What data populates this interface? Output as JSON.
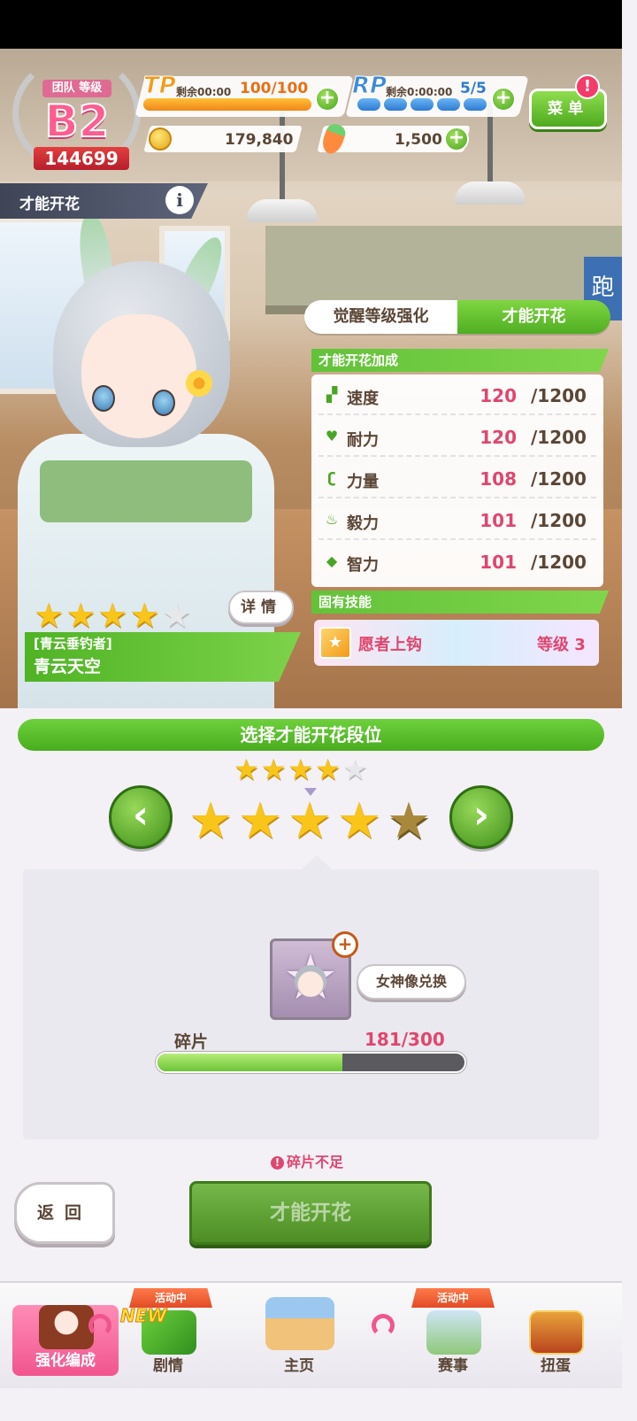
{
  "header": {
    "team_rank_label": "团队 等级",
    "team_grade": "B2",
    "team_score": "144699",
    "tp": {
      "label": "TP",
      "remaining": "剩余00:00",
      "value": "100/100",
      "fill": 1.0
    },
    "rp": {
      "label": "RP",
      "remaining": "剩余0:00:00",
      "value": "5/5",
      "pips": 5
    },
    "coins": "179,840",
    "carrots": "1,500",
    "menu_label": "菜单",
    "menu_alert": "!"
  },
  "page": {
    "title": "才能开花",
    "info_icon": "i"
  },
  "tabs": [
    {
      "label": "觉醒等级强化",
      "active": false
    },
    {
      "label": "才能开花",
      "active": true
    }
  ],
  "bonus": {
    "section_label": "才能开花加成",
    "stats": [
      {
        "icon": "shoe-icon",
        "name": "速度",
        "value": "120",
        "max": "/1200"
      },
      {
        "icon": "heart-icon",
        "name": "耐力",
        "value": "120",
        "max": "/1200"
      },
      {
        "icon": "muscle-icon",
        "name": "力量",
        "value": "108",
        "max": "/1200"
      },
      {
        "icon": "flame-icon",
        "name": "毅力",
        "value": "101",
        "max": "/1200"
      },
      {
        "icon": "graduation-cap-icon",
        "name": "智力",
        "value": "101",
        "max": "/1200"
      }
    ]
  },
  "unique_skill": {
    "section_label": "固有技能",
    "name": "愿者上钩",
    "level": "等级 3"
  },
  "character": {
    "stars": 4,
    "max_stars": 5,
    "detail_label": "详情",
    "title": "[青云垂钓者]",
    "name": "青云天空"
  },
  "bloom": {
    "section_label": "选择才能开花段位",
    "current_stars": 4,
    "target_stars": 5,
    "prev_arrow": "‹",
    "next_arrow": "›",
    "exchange_label": "女神像兑换",
    "shard_label": "碎片",
    "shard_count": "181/300",
    "shard_progress": 0.603,
    "warning": "碎片不足",
    "back_label": "返回",
    "confirm_label": "才能开花"
  },
  "bottom_nav": [
    {
      "label": "强化编成",
      "active": true,
      "tag": ""
    },
    {
      "label": "剧情",
      "active": false,
      "tag": "活动中",
      "new": "NEW"
    },
    {
      "label": "主页",
      "active": false,
      "tag": ""
    },
    {
      "label": "赛事",
      "active": false,
      "tag": "活动中"
    },
    {
      "label": "扭蛋",
      "active": false,
      "tag": ""
    }
  ],
  "colors": {
    "accent_green": "#4fae22",
    "value_pink": "#e0466d",
    "text_brown": "#5b4636"
  }
}
